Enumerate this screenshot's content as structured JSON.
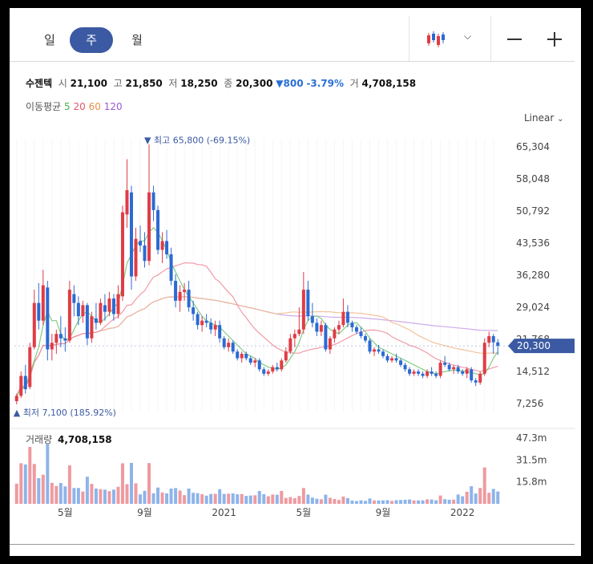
{
  "periods": [
    {
      "label": "일",
      "active": false
    },
    {
      "label": "주",
      "active": true
    },
    {
      "label": "월",
      "active": false
    }
  ],
  "quote": {
    "name": "수젠텍",
    "open_label": "시",
    "open": "21,100",
    "high_label": "고",
    "high": "21,850",
    "low_label": "저",
    "low": "18,250",
    "close_label": "종",
    "close": "20,300",
    "change_arrow": "▼",
    "change": "800",
    "change_pct": "-3.79%",
    "volume_label": "거",
    "volume": "4,708,158"
  },
  "ma": {
    "label": "이동평균",
    "items": [
      {
        "label": "5",
        "color": "#4caf50"
      },
      {
        "label": "20",
        "color": "#e5566a"
      },
      {
        "label": "60",
        "color": "#e8914a"
      },
      {
        "label": "120",
        "color": "#9b59d0"
      }
    ]
  },
  "scale_label": "Linear",
  "colors": {
    "up": "#e03c45",
    "down": "#2c6ad3",
    "price_tag": "#3b5aa3"
  },
  "chart_data": {
    "type": "candlestick",
    "y_ticks": [
      "65,304",
      "58,048",
      "50,792",
      "43,536",
      "36,280",
      "29,024",
      "21,768",
      "14,512",
      "7,256"
    ],
    "y_tick_values": [
      65304,
      58048,
      50792,
      43536,
      36280,
      29024,
      21768,
      14512,
      7256
    ],
    "x_ticks": [
      "5월",
      "9월",
      "2021",
      "5월",
      "9월",
      "2022"
    ],
    "x_tick_index": [
      11,
      29,
      47,
      65,
      83,
      101
    ],
    "current_price": 20300,
    "current_price_label": "20,300",
    "max_label": "최고 65,800 (-69.15%)",
    "max_value": 65800,
    "max_index": 30,
    "min_label": "최저 7,100 (185.92%)",
    "min_value": 7100,
    "min_index": 0,
    "candles": [
      [
        7800,
        9500,
        7100,
        9000
      ],
      [
        9000,
        14500,
        8500,
        13500
      ],
      [
        13500,
        16000,
        9500,
        10500
      ],
      [
        11000,
        21000,
        10500,
        20000
      ],
      [
        20000,
        33000,
        19500,
        30000
      ],
      [
        30000,
        34500,
        24000,
        26000
      ],
      [
        26000,
        37500,
        25000,
        34000
      ],
      [
        33500,
        35000,
        17000,
        19500
      ],
      [
        19500,
        23000,
        17000,
        21000
      ],
      [
        21000,
        24000,
        18500,
        23000
      ],
      [
        23000,
        27000,
        20000,
        22000
      ],
      [
        22000,
        24500,
        19000,
        21500
      ],
      [
        21500,
        35000,
        21000,
        33000
      ],
      [
        32000,
        34000,
        27000,
        30000
      ],
      [
        30000,
        31500,
        25000,
        27000
      ],
      [
        27000,
        30500,
        25500,
        29500
      ],
      [
        29500,
        30000,
        20500,
        22000
      ],
      [
        22000,
        28000,
        21000,
        27000
      ],
      [
        26500,
        30000,
        24000,
        25500
      ],
      [
        25500,
        31000,
        25000,
        30000
      ],
      [
        29500,
        32000,
        26000,
        28000
      ],
      [
        28000,
        32500,
        27000,
        31000
      ],
      [
        31000,
        32000,
        26000,
        27500
      ],
      [
        27500,
        34000,
        26500,
        32000
      ],
      [
        31500,
        52000,
        30500,
        50500
      ],
      [
        50000,
        62500,
        47000,
        55500
      ],
      [
        55000,
        56500,
        33000,
        36000
      ],
      [
        36000,
        47000,
        35000,
        44500
      ],
      [
        44000,
        47500,
        41500,
        43000
      ],
      [
        43000,
        46000,
        38000,
        39500
      ],
      [
        39500,
        65800,
        38500,
        55000
      ],
      [
        55000,
        56500,
        48500,
        51000
      ],
      [
        51000,
        52000,
        41000,
        42000
      ],
      [
        42000,
        46000,
        39000,
        44000
      ],
      [
        44000,
        46500,
        40000,
        41000
      ],
      [
        41000,
        42500,
        34000,
        35000
      ],
      [
        35000,
        36500,
        29000,
        30500
      ],
      [
        30500,
        34000,
        28000,
        32500
      ],
      [
        32500,
        34500,
        30500,
        33000
      ],
      [
        33000,
        35000,
        28000,
        29000
      ],
      [
        29000,
        30500,
        26000,
        27500
      ],
      [
        27500,
        28000,
        24000,
        25000
      ],
      [
        25000,
        27000,
        23500,
        26000
      ],
      [
        26000,
        27500,
        24500,
        25500
      ],
      [
        25500,
        26500,
        23000,
        24000
      ],
      [
        24000,
        26000,
        22500,
        25000
      ],
      [
        25000,
        26000,
        21000,
        22000
      ],
      [
        22000,
        22500,
        19500,
        20000
      ],
      [
        20000,
        22000,
        19000,
        21000
      ],
      [
        21000,
        21500,
        18500,
        19000
      ],
      [
        19000,
        19500,
        17000,
        17500
      ],
      [
        17500,
        19000,
        16500,
        18500
      ],
      [
        18500,
        19000,
        17000,
        17500
      ],
      [
        17500,
        18000,
        16000,
        16500
      ],
      [
        16500,
        17500,
        15500,
        17000
      ],
      [
        17000,
        17500,
        14500,
        15000
      ],
      [
        15000,
        15500,
        13500,
        14000
      ],
      [
        14000,
        15000,
        13500,
        14500
      ],
      [
        14500,
        16000,
        14000,
        15500
      ],
      [
        15500,
        16500,
        14500,
        15000
      ],
      [
        15000,
        17500,
        14500,
        17000
      ],
      [
        17000,
        20000,
        16500,
        19000
      ],
      [
        19000,
        23000,
        18500,
        22000
      ],
      [
        22000,
        24000,
        20000,
        23000
      ],
      [
        23000,
        29000,
        22500,
        24000
      ],
      [
        24000,
        37000,
        23000,
        33000
      ],
      [
        33000,
        35000,
        26000,
        27000
      ],
      [
        27000,
        30000,
        24500,
        25500
      ],
      [
        25500,
        26500,
        22500,
        23500
      ],
      [
        23500,
        26000,
        22500,
        25000
      ],
      [
        25000,
        25500,
        19000,
        19500
      ],
      [
        19500,
        22500,
        18500,
        22000
      ],
      [
        22000,
        24500,
        21000,
        24000
      ],
      [
        24000,
        26000,
        23000,
        25000
      ],
      [
        25000,
        31000,
        24500,
        28000
      ],
      [
        28000,
        29500,
        24500,
        25500
      ],
      [
        25500,
        26000,
        23500,
        24500
      ],
      [
        24500,
        25000,
        23000,
        23500
      ],
      [
        23500,
        24500,
        22000,
        22500
      ],
      [
        22500,
        23000,
        21000,
        21500
      ],
      [
        21500,
        22000,
        18500,
        19000
      ],
      [
        19000,
        20000,
        18000,
        19500
      ],
      [
        19500,
        20500,
        18500,
        19000
      ],
      [
        19000,
        19500,
        17500,
        18000
      ],
      [
        18000,
        18500,
        16500,
        17000
      ],
      [
        17000,
        18000,
        16500,
        17500
      ],
      [
        17500,
        18500,
        16500,
        17000
      ],
      [
        17000,
        17500,
        15500,
        16000
      ],
      [
        16000,
        16500,
        14500,
        15000
      ],
      [
        15000,
        15500,
        13500,
        14000
      ],
      [
        14000,
        15000,
        13500,
        14500
      ],
      [
        14500,
        15000,
        13500,
        14000
      ],
      [
        14000,
        14500,
        13000,
        13500
      ],
      [
        13500,
        15000,
        13000,
        14500
      ],
      [
        14500,
        15500,
        13500,
        14000
      ],
      [
        14000,
        14500,
        13000,
        13500
      ],
      [
        13500,
        17000,
        13000,
        16500
      ],
      [
        16500,
        18000,
        15500,
        16000
      ],
      [
        16000,
        16500,
        14500,
        15000
      ],
      [
        15000,
        16000,
        14000,
        15500
      ],
      [
        15500,
        16000,
        14000,
        14500
      ],
      [
        14500,
        15000,
        13500,
        14000
      ],
      [
        14000,
        15500,
        13000,
        15000
      ],
      [
        15000,
        15500,
        12000,
        12500
      ],
      [
        12500,
        13000,
        11200,
        12000
      ],
      [
        12000,
        14500,
        11500,
        14000
      ],
      [
        14000,
        22000,
        13500,
        21000
      ],
      [
        21000,
        23500,
        20000,
        22500
      ],
      [
        22500,
        23000,
        18500,
        21100
      ],
      [
        21100,
        21850,
        18250,
        20300
      ]
    ],
    "ma5": [
      9000,
      10500,
      11000,
      14000,
      17000,
      20000,
      25000,
      28000,
      26000,
      26000,
      23000,
      21500,
      22000,
      24000,
      26000,
      27500,
      28000,
      27000,
      26000,
      25500,
      26500,
      27500,
      29000,
      30000,
      34000,
      39000,
      41000,
      43000,
      44000,
      44000,
      46000,
      47000,
      46000,
      44000,
      42000,
      39000,
      37000,
      35000,
      33000,
      31500,
      30000,
      28500,
      27000,
      26000,
      25500,
      25000,
      24500,
      23500,
      22500,
      21500,
      20500,
      19500,
      18500,
      18000,
      17500,
      16500,
      16000,
      15500,
      15200,
      15000,
      15300,
      16000,
      17500,
      19000,
      21000,
      24000,
      26000,
      27000,
      27000,
      26500,
      25000,
      24000,
      23500,
      23000,
      24000,
      25000,
      25500,
      25500,
      24500,
      23500,
      22000,
      21000,
      20000,
      19500,
      19000,
      18500,
      18000,
      17500,
      17000,
      16500,
      16000,
      15500,
      15000,
      14500,
      14200,
      14000,
      14200,
      14500,
      14700,
      14800,
      14800,
      14600,
      14500,
      14300,
      14000,
      13800,
      14000,
      15500,
      17500,
      19000
    ]
  }
}
